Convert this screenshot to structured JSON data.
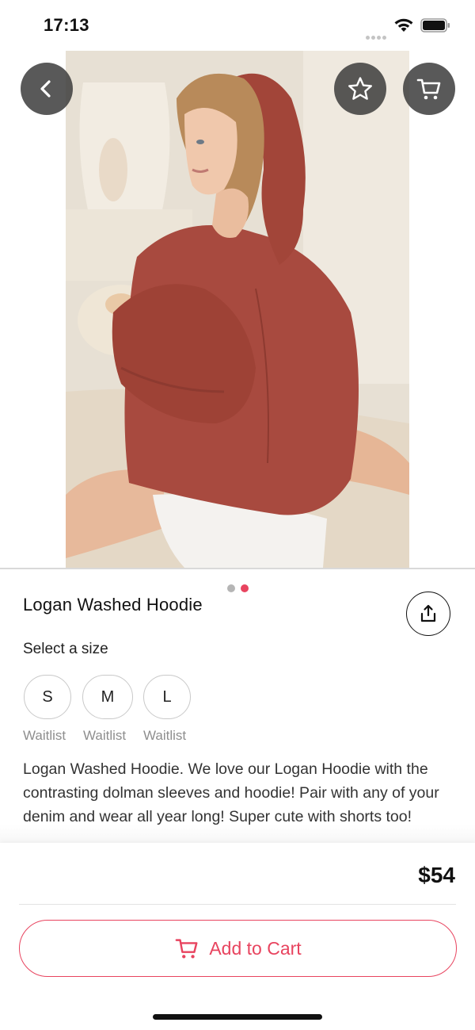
{
  "status_bar": {
    "time": "17:13",
    "icons": [
      "signal-dots-icon",
      "wifi-icon",
      "battery-icon"
    ]
  },
  "header": {
    "icons": [
      "chevron-left-icon",
      "star-icon",
      "cart-icon"
    ]
  },
  "gallery": {
    "current_index": 2,
    "total": 2
  },
  "product": {
    "title": "Logan Washed Hoodie",
    "size_heading": "Select a size",
    "sizes": [
      {
        "label": "S",
        "status": "Waitlist"
      },
      {
        "label": "M",
        "status": "Waitlist"
      },
      {
        "label": "L",
        "status": "Waitlist"
      }
    ],
    "description": "Logan Washed Hoodie. We love our Logan Hoodie with the contrasting dolman sleeves and hoodie! Pair with any of your denim and wear all year long! Super cute with shorts too!",
    "share_icon": "share-icon"
  },
  "footer": {
    "price": "$54",
    "add_to_cart_label": "Add to Cart",
    "add_to_cart_icon": "cart-icon"
  },
  "colors": {
    "accent": "#e8445f",
    "hoodie": "#a84a3f",
    "button_bg": "#3c3c3c"
  }
}
